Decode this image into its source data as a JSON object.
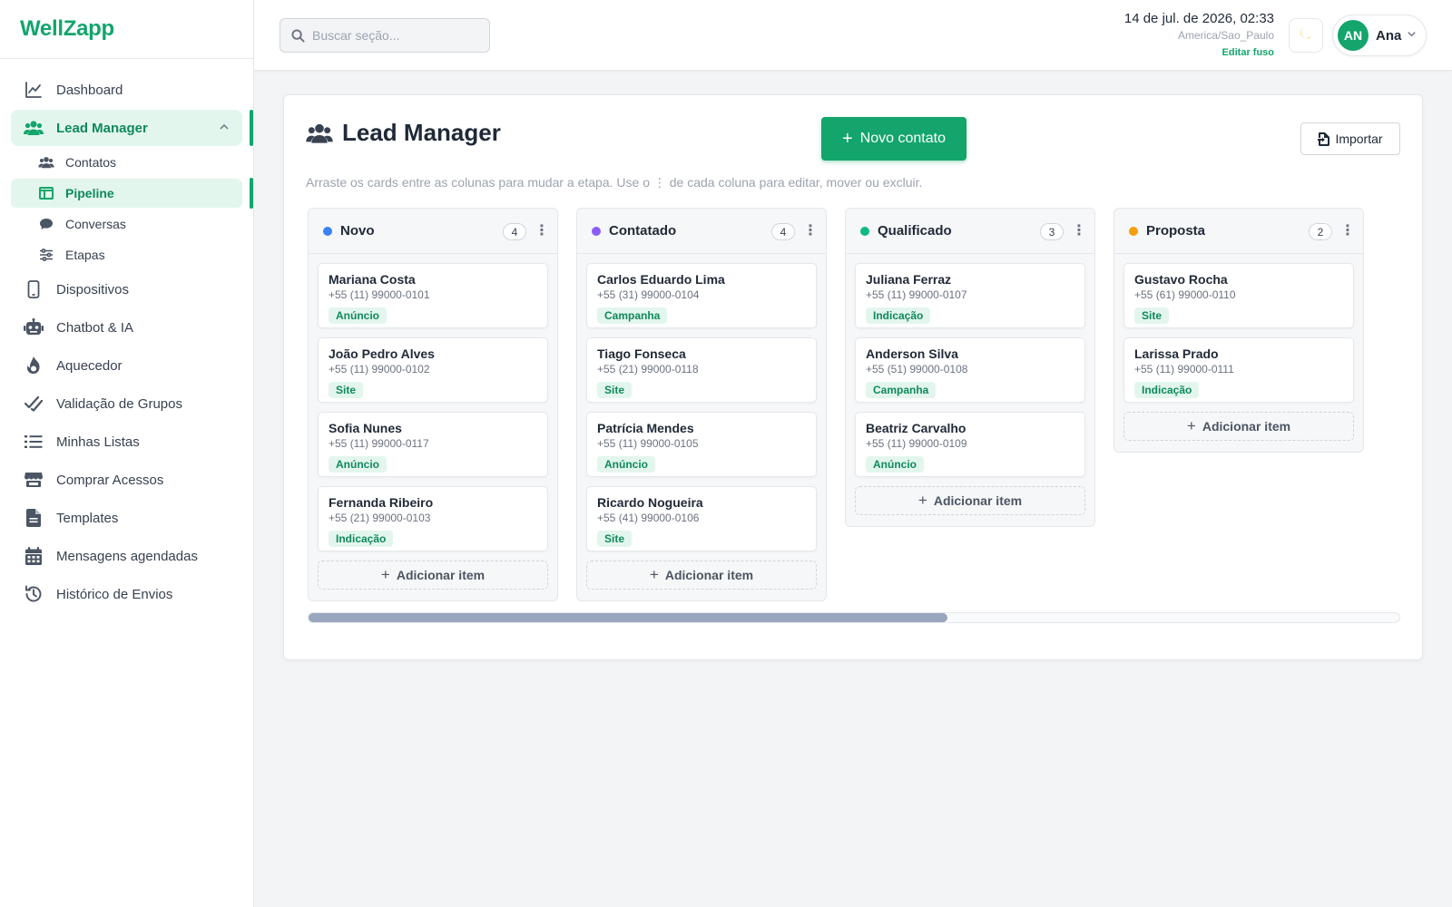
{
  "brand": {
    "name": "WellZapp",
    "color": "#13a56b"
  },
  "sidebar": {
    "items": [
      {
        "label": "Dashboard",
        "icon": "chart-line-icon"
      },
      {
        "label": "Lead Manager",
        "icon": "users-icon",
        "active": true,
        "expanded": true
      },
      {
        "label": "Dispositivos",
        "icon": "phone-icon"
      },
      {
        "label": "Chatbot & IA",
        "icon": "robot-icon"
      },
      {
        "label": "Aquecedor",
        "icon": "flame-icon"
      },
      {
        "label": "Validação de Grupos",
        "icon": "double-check-icon"
      },
      {
        "label": "Minhas Listas",
        "icon": "list-icon"
      },
      {
        "label": "Comprar Acessos",
        "icon": "store-icon"
      },
      {
        "label": "Templates",
        "icon": "file-icon"
      },
      {
        "label": "Mensagens agendadas",
        "icon": "calendar-icon"
      },
      {
        "label": "Histórico de Envios",
        "icon": "history-icon"
      }
    ],
    "subitems": [
      {
        "label": "Contatos",
        "icon": "users-small-icon"
      },
      {
        "label": "Pipeline",
        "icon": "columns-icon",
        "active": true
      },
      {
        "label": "Conversas",
        "icon": "chat-icon"
      },
      {
        "label": "Etapas",
        "icon": "sliders-icon"
      }
    ]
  },
  "header": {
    "search_placeholder": "Buscar seção...",
    "datetime": "14 de jul. de 2026, 02:33",
    "timezone": "America/Sao_Paulo",
    "edit_timezone": "Editar fuso",
    "theme_icon": "moon-icon",
    "user": {
      "initials": "AN",
      "name": "Ana"
    }
  },
  "page": {
    "title": "Lead Manager",
    "new_contact": "Novo contato",
    "import": "Importar",
    "hint": "Arraste os cards entre as colunas para mudar a etapa. Use o ⋮ de cada coluna para editar, mover ou excluir."
  },
  "board": {
    "add_item_label": "Adicionar item",
    "columns": [
      {
        "title": "Novo",
        "count": "4",
        "color": "#3b82f6",
        "cards": [
          {
            "name": "Mariana Costa",
            "phone": "+55 (11) 99000-0101",
            "tag": "Anúncio"
          },
          {
            "name": "João Pedro Alves",
            "phone": "+55 (11) 99000-0102",
            "tag": "Site"
          },
          {
            "name": "Sofia Nunes",
            "phone": "+55 (11) 99000-0117",
            "tag": "Anúncio"
          },
          {
            "name": "Fernanda Ribeiro",
            "phone": "+55 (21) 99000-0103",
            "tag": "Indicação"
          }
        ]
      },
      {
        "title": "Contatado",
        "count": "4",
        "color": "#8b5cf6",
        "cards": [
          {
            "name": "Carlos Eduardo Lima",
            "phone": "+55 (31) 99000-0104",
            "tag": "Campanha"
          },
          {
            "name": "Tiago Fonseca",
            "phone": "+55 (21) 99000-0118",
            "tag": "Site"
          },
          {
            "name": "Patrícia Mendes",
            "phone": "+55 (11) 99000-0105",
            "tag": "Anúncio"
          },
          {
            "name": "Ricardo Nogueira",
            "phone": "+55 (41) 99000-0106",
            "tag": "Site"
          }
        ]
      },
      {
        "title": "Qualificado",
        "count": "3",
        "color": "#10b981",
        "cards": [
          {
            "name": "Juliana Ferraz",
            "phone": "+55 (11) 99000-0107",
            "tag": "Indicação"
          },
          {
            "name": "Anderson Silva",
            "phone": "+55 (51) 99000-0108",
            "tag": "Campanha"
          },
          {
            "name": "Beatriz Carvalho",
            "phone": "+55 (11) 99000-0109",
            "tag": "Anúncio"
          }
        ]
      },
      {
        "title": "Proposta",
        "count": "2",
        "color": "#f59e0b",
        "cards": [
          {
            "name": "Gustavo Rocha",
            "phone": "+55 (61) 99000-0110",
            "tag": "Site"
          },
          {
            "name": "Larissa Prado",
            "phone": "+55 (11) 99000-0111",
            "tag": "Indicação"
          }
        ]
      }
    ]
  },
  "scroll": {
    "position_fraction": 0.58
  }
}
